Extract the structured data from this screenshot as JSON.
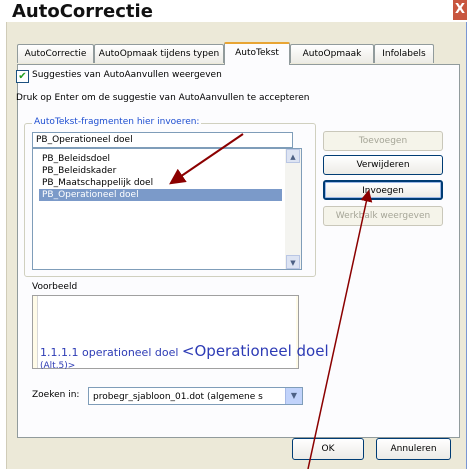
{
  "window": {
    "title": "AutoCorrectie",
    "close_glyph": "X"
  },
  "tabs": [
    {
      "label": "AutoCorrectie"
    },
    {
      "label": "AutoOpmaak tijdens typen"
    },
    {
      "label": "AutoTekst"
    },
    {
      "label": "AutoOpmaak"
    },
    {
      "label": "Infolabels"
    }
  ],
  "active_tab": "AutoTekst",
  "checkbox": {
    "label": "Suggesties van AutoAanvullen weergeven",
    "checked": true
  },
  "hint": "Druk op Enter om de suggestie van AutoAanvullen te accepteren",
  "group_label": "AutoTekst-fragmenten hier invoeren:",
  "entry_value": "PB_Operationeel doel",
  "list_items": [
    "PB_Beleidsdoel",
    "PB_Beleidskader",
    "PB_Maatschappelijk doel",
    "PB_Operationeel doel"
  ],
  "selected_item": "PB_Operationeel doel",
  "buttons": {
    "add": "Toevoegen",
    "delete": "Verwijderen",
    "insert": "Invoegen",
    "toolbar": "Werkbalk weergeven"
  },
  "preview": {
    "label": "Voorbeeld",
    "number": "1.1.1.1 operationeel doel",
    "field": "<Operationeel doel",
    "tail": "(Alt.5)>"
  },
  "search": {
    "label": "Zoeken in:",
    "value": "probegr_sjabloon_01.dot (algemene s"
  },
  "footer": {
    "ok": "OK",
    "cancel": "Annuleren"
  },
  "colors": {
    "accent": "#8b0000",
    "selection": "#7b9ac9",
    "link": "#2d3bb5"
  }
}
